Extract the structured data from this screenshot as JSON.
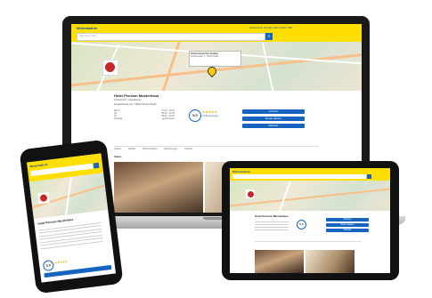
{
  "laptop": {
    "brand": "Meinestadt.de",
    "header_links": "Unternehmen eintragen | Mein Konto | Hilfe",
    "search_what_placeholder": "Was suchen Sie?",
    "search_where_placeholder": "Wo?",
    "map_popup_title": "Schlosshotel Zum Greifen",
    "map_popup_address": "Schlossplatz 1, 74523 Stadt",
    "business": {
      "name": "Hotel Pension Musterhaus",
      "category": "Unterkunft, Gästehaus",
      "address": "Hauptstraße 12, 74523 Musterstadt",
      "rating": "5.0",
      "stars": "★★★★★",
      "reviews": "10 Bewertungen",
      "hours": [
        {
          "day": "Mo-Fr",
          "time": "07:00 - 22:00"
        },
        {
          "day": "Sa",
          "time": "08:00 - 22:00"
        },
        {
          "day": "So",
          "time": "08:00 - 20:00"
        },
        {
          "day": "Feiertag",
          "time": "geschlossen"
        }
      ],
      "buttons": [
        "Anrufen",
        "Route planen",
        "Website"
      ]
    },
    "tabs": [
      "Galerie",
      "Details",
      "Öffnungszeiten",
      "Bewertungen",
      "Kontakt"
    ],
    "gallery_label": "Galerie"
  },
  "tablet": {
    "brand": "Meinestadt.de",
    "business_name": "Hotel Pension Musterhaus",
    "rating": "5.0",
    "buttons": [
      "Anrufen",
      "Route planen",
      "Website"
    ]
  },
  "phone": {
    "brand": "Meinestadt.de",
    "business_name": "Hotel Pension Musterhaus",
    "rating": "5.0",
    "stars": "★★★★★"
  }
}
